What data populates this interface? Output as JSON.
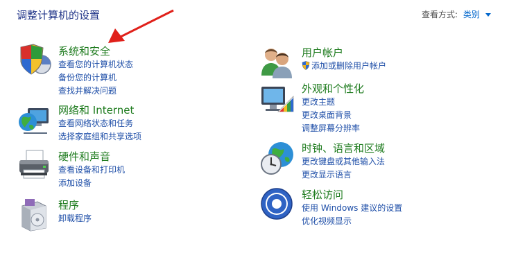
{
  "header": {
    "title": "调整计算机的设置",
    "view_by_label": "查看方式:",
    "view_by_value": "类别"
  },
  "categories_left": [
    {
      "title": "系统和安全",
      "icon": "shield-computer-icon",
      "links": [
        "查看您的计算机状态",
        "备份您的计算机",
        "查找并解决问题"
      ]
    },
    {
      "title": "网络和 Internet",
      "icon": "network-globe-icon",
      "links": [
        "查看网络状态和任务",
        "选择家庭组和共享选项"
      ]
    },
    {
      "title": "硬件和声音",
      "icon": "printer-icon",
      "links": [
        "查看设备和打印机",
        "添加设备"
      ]
    },
    {
      "title": "程序",
      "icon": "programs-box-icon",
      "links": [
        "卸载程序"
      ]
    }
  ],
  "categories_right": [
    {
      "title": "用户帐户",
      "icon": "users-icon",
      "links": [
        "添加或删除用户帐户"
      ]
    },
    {
      "title": "外观和个性化",
      "icon": "monitor-palette-icon",
      "links": [
        "更改主题",
        "更改桌面背景",
        "调整屏幕分辨率"
      ]
    },
    {
      "title": "时钟、语言和区域",
      "icon": "clock-globe-icon",
      "links": [
        "更改键盘或其他输入法",
        "更改显示语言"
      ]
    },
    {
      "title": "轻松访问",
      "icon": "accessibility-icon",
      "links": [
        "使用 Windows 建议的设置",
        "优化视频显示"
      ]
    }
  ],
  "colors": {
    "title_blue": "#1e3287",
    "category_green": "#1e7b1e",
    "link_blue": "#1f4fa8",
    "annotation_red": "#e0201a"
  }
}
